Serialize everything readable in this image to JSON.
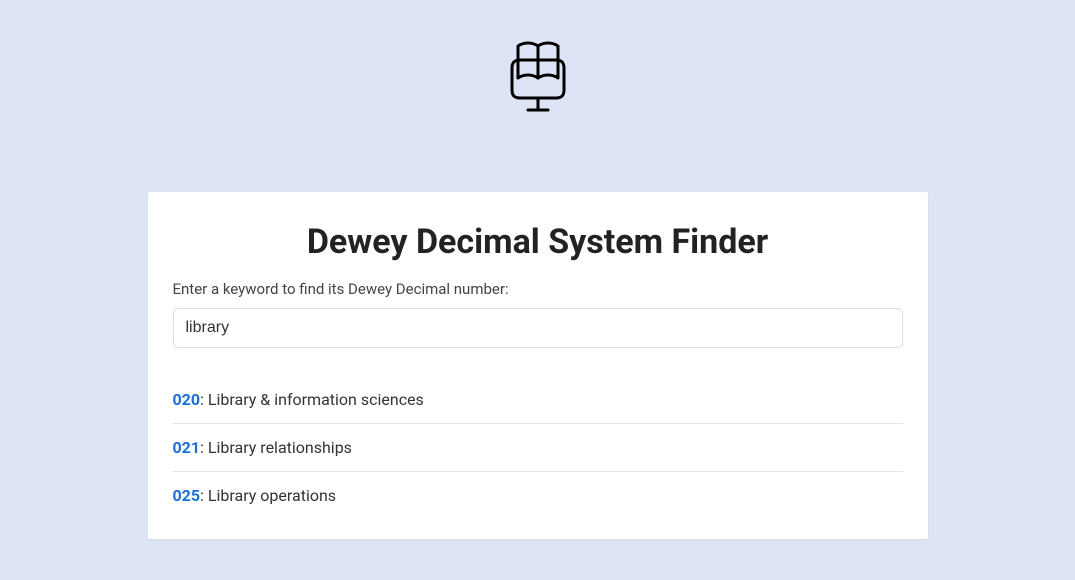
{
  "header": {
    "title": "Dewey Decimal System Finder",
    "prompt": "Enter a keyword to find its Dewey Decimal number:"
  },
  "search": {
    "value": "library",
    "placeholder": ""
  },
  "results": [
    {
      "number": "020",
      "label": "Library & information sciences"
    },
    {
      "number": "021",
      "label": "Library relationships"
    },
    {
      "number": "025",
      "label": "Library operations"
    }
  ]
}
